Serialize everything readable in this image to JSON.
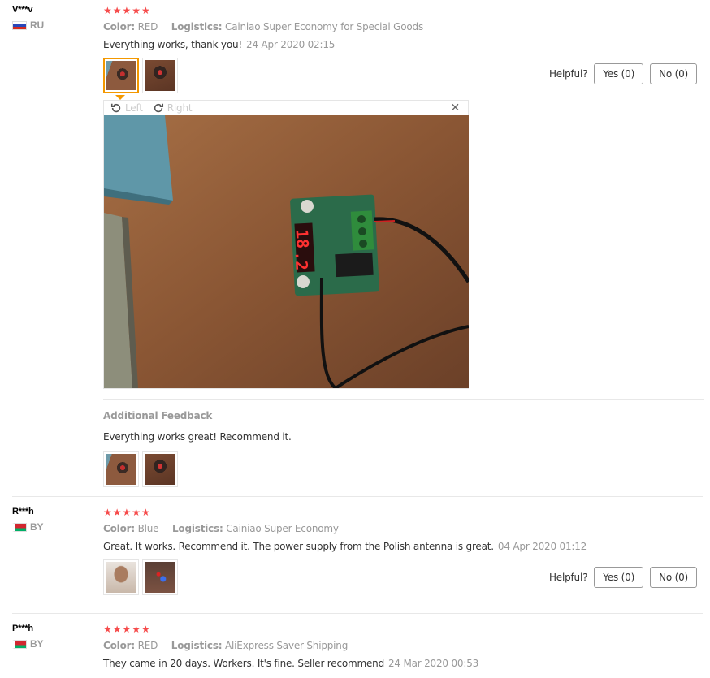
{
  "labels": {
    "color": "Color:",
    "logistics": "Logistics:",
    "helpful": "Helpful?",
    "additional_feedback": "Additional Feedback",
    "left": "Left",
    "right": "Right"
  },
  "reviews": [
    {
      "user": "V***v",
      "country": "RU",
      "rating": "★★★★★",
      "color": "RED",
      "logistics": "Cainiao Super Economy for Special Goods",
      "content": "Everything works, thank you!",
      "date": "24 Apr 2020 02:15",
      "yes": "Yes (0)",
      "no": "No (0)",
      "additional": "Everything works great! Recommend it."
    },
    {
      "user": "R***h",
      "country": "BY",
      "rating": "★★★★★",
      "color": "Blue",
      "logistics": "Cainiao Super Economy",
      "content": "Great. It works. Recommend it. The power supply from the Polish antenna is great.",
      "date": "04 Apr 2020 01:12",
      "yes": "Yes (0)",
      "no": "No (0)"
    },
    {
      "user": "P***h",
      "country": "BY",
      "rating": "★★★★★",
      "color": "RED",
      "logistics": "AliExpress Saver Shipping",
      "content": "They came in 20 days. Workers. It's fine. Seller recommend",
      "date": "24 Mar 2020 00:53"
    }
  ],
  "viewer_display": {
    "left": "1",
    "right": "2"
  },
  "icons": {
    "rotate_left": "rotate-left-icon",
    "rotate_right": "rotate-right-icon",
    "close": "close-icon"
  },
  "colors": {
    "stars": "#f64b4b",
    "active_thumb": "#f39800",
    "muted": "#999999"
  }
}
